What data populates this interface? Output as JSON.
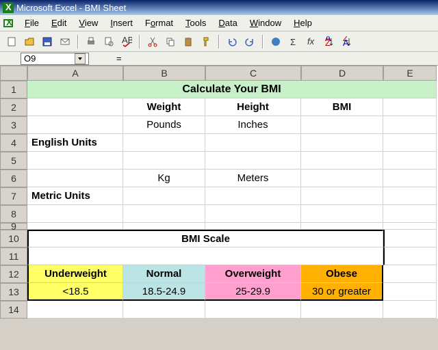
{
  "title": "Microsoft Excel - BMI Sheet",
  "menu": [
    "File",
    "Edit",
    "View",
    "Insert",
    "Format",
    "Tools",
    "Data",
    "Window",
    "Help"
  ],
  "namebox": "O9",
  "columns": [
    "A",
    "B",
    "C",
    "D",
    "E"
  ],
  "rows": [
    "1",
    "2",
    "3",
    "4",
    "5",
    "6",
    "7",
    "8",
    "9",
    "10",
    "11",
    "12",
    "13",
    "14"
  ],
  "cells": {
    "title": "Calculate Your BMI",
    "weight": "Weight",
    "height": "Height",
    "bmi": "BMI",
    "pounds": "Pounds",
    "inches": "Inches",
    "english": "English Units",
    "kg": "Kg",
    "meters": "Meters",
    "metric": "Metric Units",
    "scale": "BMI Scale",
    "uw": "Underweight",
    "nm": "Normal",
    "ow": "Overweight",
    "ob": "Obese",
    "uw_v": "<18.5",
    "nm_v": "18.5-24.9",
    "ow_v": "25-29.9",
    "ob_v": "30 or greater"
  },
  "colors": {
    "uw": "#ffff66",
    "nm": "#bce4e5",
    "ow": "#ffa0ce",
    "ob": "#ffb000"
  },
  "eq": "="
}
